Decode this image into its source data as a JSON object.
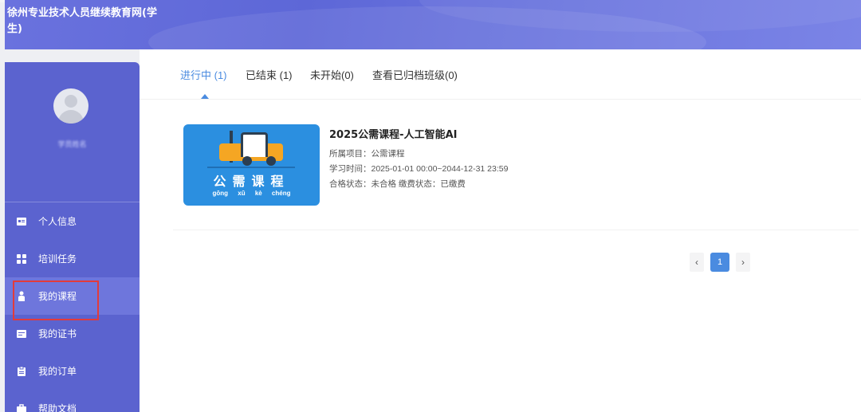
{
  "header": {
    "site_title": "徐州专业技术人员继续教育网(学生)"
  },
  "sidebar": {
    "username": "学员姓名",
    "items": [
      {
        "label": "个人信息",
        "icon": "id-card-icon"
      },
      {
        "label": "培训任务",
        "icon": "grid-icon"
      },
      {
        "label": "我的课程",
        "icon": "student-icon",
        "active": true
      },
      {
        "label": "我的证书",
        "icon": "certificate-icon"
      },
      {
        "label": "我的订单",
        "icon": "clipboard-icon"
      },
      {
        "label": "帮助文档",
        "icon": "briefcase-icon"
      }
    ]
  },
  "tabs": [
    {
      "label": "进行中 (1)",
      "active": true
    },
    {
      "label": "已结束 (1)"
    },
    {
      "label": "未开始(0)"
    },
    {
      "label": "查看已归档班级(0)"
    }
  ],
  "course": {
    "title": "2025公需课程-人工智能AI",
    "project": "所属项目：公需课程",
    "study_time": "学习时间：2025-01-01 00:00~2044-12-31 23:59",
    "status": "合格状态：未合格   缴费状态：已缴费",
    "thumb_title": "公需课程",
    "thumb_pinyin": "gōng xū kè chéng"
  },
  "pagination": {
    "prev": "‹",
    "current": "1",
    "next": "›"
  },
  "colors": {
    "accent": "#4a8be0",
    "sidebar": "#5b63cf",
    "highlight": "#e23b3b"
  }
}
